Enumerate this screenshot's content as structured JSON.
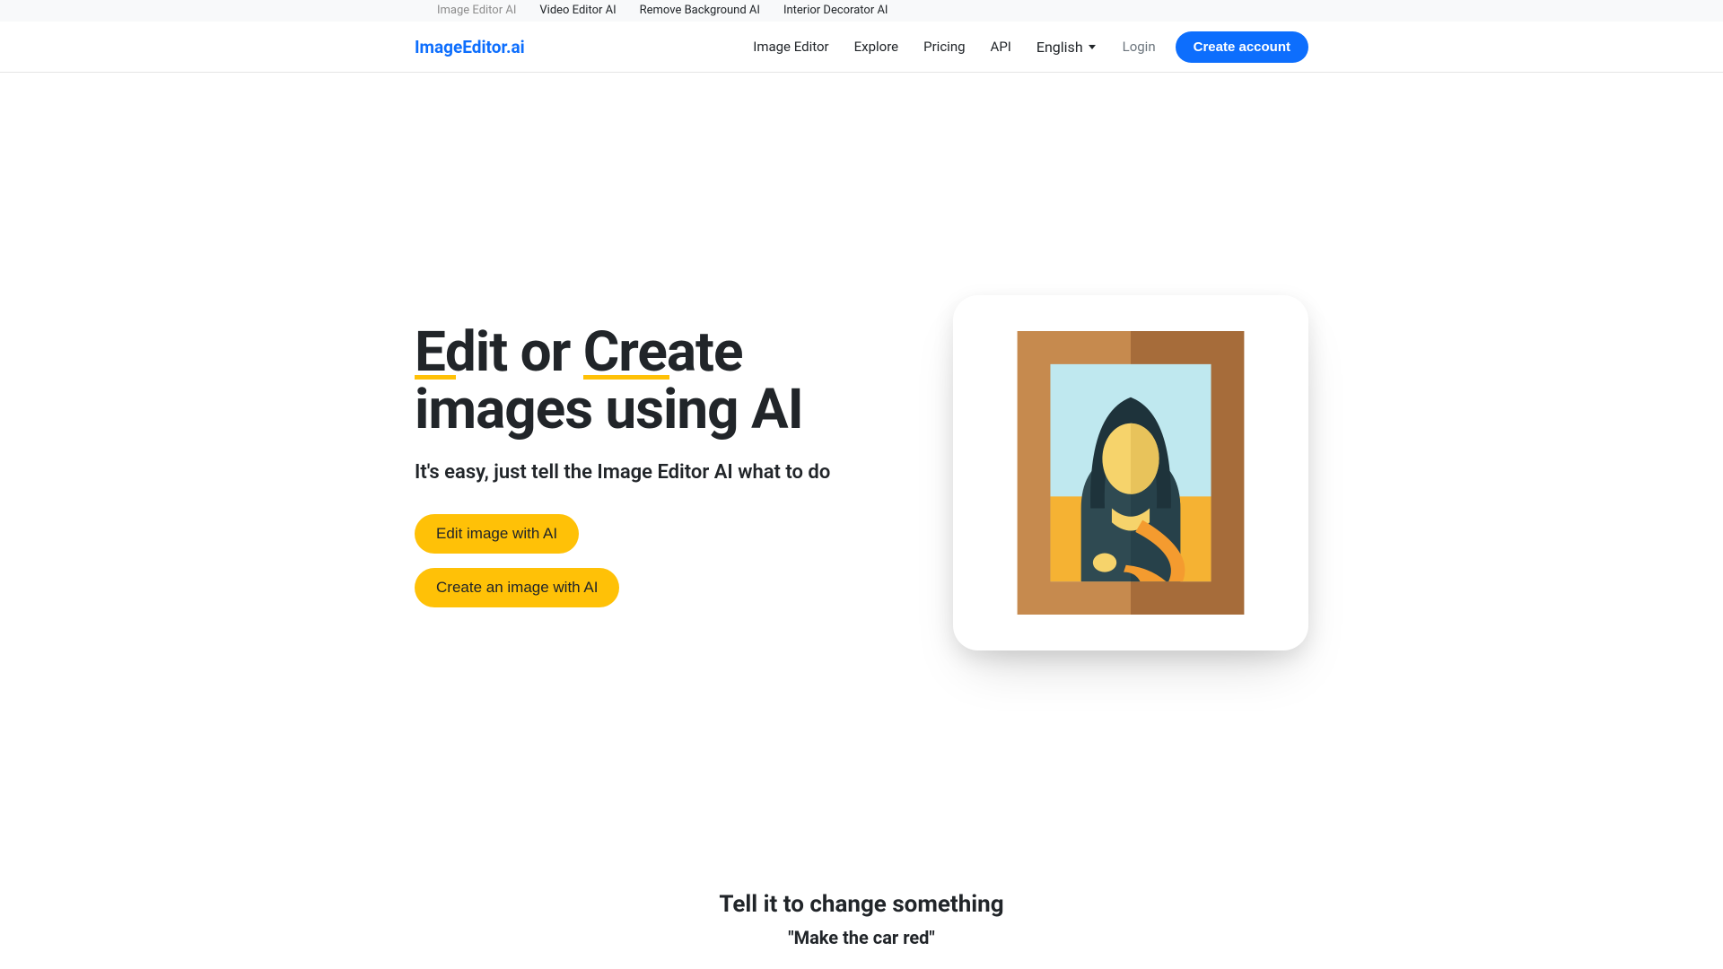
{
  "topnav": {
    "items": [
      {
        "label": "Image Editor AI",
        "active": true
      },
      {
        "label": "Video Editor AI",
        "active": false
      },
      {
        "label": "Remove Background AI",
        "active": false
      },
      {
        "label": "Interior Decorator AI",
        "active": false
      }
    ]
  },
  "navbar": {
    "brand": "ImageEditor.ai",
    "links": {
      "image_editor": "Image Editor",
      "explore": "Explore",
      "pricing": "Pricing",
      "api": "API",
      "language": "English"
    },
    "login": "Login",
    "create_account": "Create account"
  },
  "hero": {
    "title_edit_prefix": "E",
    "title_edit_rest": "dit or ",
    "title_create_prefix": "Cre",
    "title_create_rest": "ate images using AI",
    "subtitle": "It's easy, just tell the Image Editor AI what to do",
    "cta_edit": "Edit image with AI",
    "cta_create": "Create an image with AI"
  },
  "section2": {
    "heading": "Tell it to change something",
    "quote": "\"Make the car red\""
  },
  "colors": {
    "primary": "#0d6efd",
    "warning": "#ffc107"
  }
}
